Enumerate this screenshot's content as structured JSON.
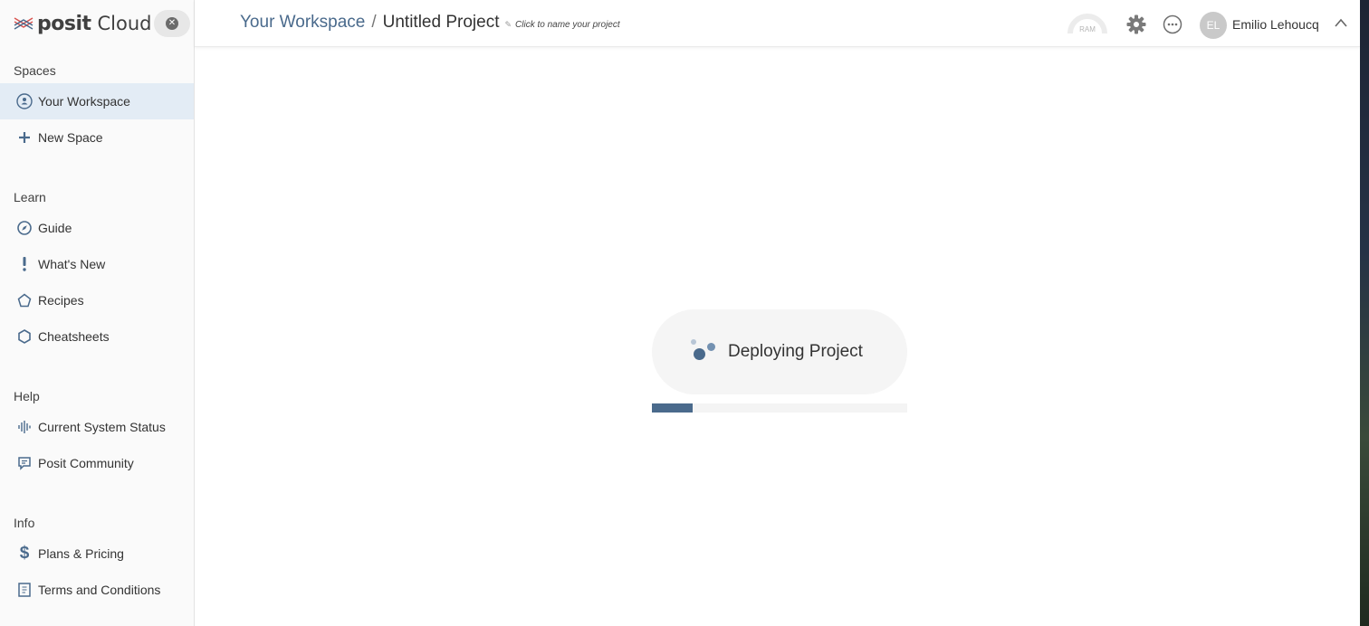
{
  "brand": {
    "name": "posit",
    "product": "Cloud"
  },
  "sidebar": {
    "sections": [
      {
        "title": "Spaces",
        "items": [
          {
            "label": "Your Workspace",
            "icon": "user-circle-icon",
            "active": true
          },
          {
            "label": "New Space",
            "icon": "plus-icon"
          }
        ]
      },
      {
        "title": "Learn",
        "items": [
          {
            "label": "Guide",
            "icon": "compass-icon"
          },
          {
            "label": "What's New",
            "icon": "exclamation-icon"
          },
          {
            "label": "Recipes",
            "icon": "recipe-icon"
          },
          {
            "label": "Cheatsheets",
            "icon": "hexagon-icon"
          }
        ]
      },
      {
        "title": "Help",
        "items": [
          {
            "label": "Current System Status",
            "icon": "pulse-icon"
          },
          {
            "label": "Posit Community",
            "icon": "chat-icon"
          }
        ]
      },
      {
        "title": "Info",
        "items": [
          {
            "label": "Plans & Pricing",
            "icon": "dollar-icon"
          },
          {
            "label": "Terms and Conditions",
            "icon": "document-icon"
          }
        ]
      }
    ]
  },
  "header": {
    "workspace_link": "Your Workspace",
    "separator": "/",
    "project_name": "Untitled Project",
    "rename_hint": "Click to name your project",
    "ram_label": "RAM",
    "user": {
      "initials": "EL",
      "name": "Emilio Lehoucq"
    }
  },
  "main": {
    "status_text": "Deploying Project",
    "progress": 0.16
  },
  "colors": {
    "accent": "#4a6a8c",
    "active_bg": "#e3ecf5",
    "sidebar_bg": "#fafafa"
  }
}
